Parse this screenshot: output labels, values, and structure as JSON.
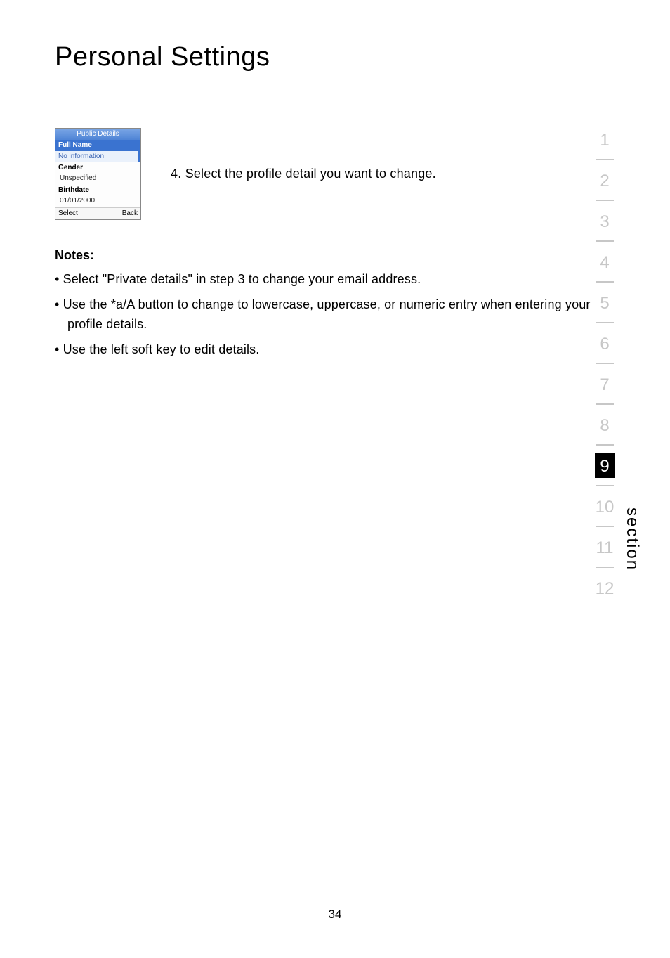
{
  "heading": "Personal Settings",
  "phone_screen": {
    "title": "Public Details",
    "rows": [
      {
        "label": "Full Name",
        "value": "No information",
        "highlighted": true
      },
      {
        "label": "Gender",
        "value": "Unspecified",
        "highlighted": false
      },
      {
        "label": "Birthdate",
        "value": "01/01/2000",
        "highlighted": false
      }
    ],
    "softkeys": {
      "left": "Select",
      "right": "Back"
    }
  },
  "step": "4.  Select the profile detail you want to change.",
  "notes_heading": "Notes:",
  "notes": [
    "Select \"Private details\" in step 3 to change your email address.",
    "Use the *a/A button to change to lowercase, uppercase, or numeric entry when entering your profile details.",
    "Use the left soft key to edit details."
  ],
  "section_label": "section",
  "nav_numbers": [
    "1",
    "2",
    "3",
    "4",
    "5",
    "6",
    "7",
    "8",
    "9",
    "10",
    "11",
    "12"
  ],
  "nav_active_index": 8,
  "page_number": "34"
}
